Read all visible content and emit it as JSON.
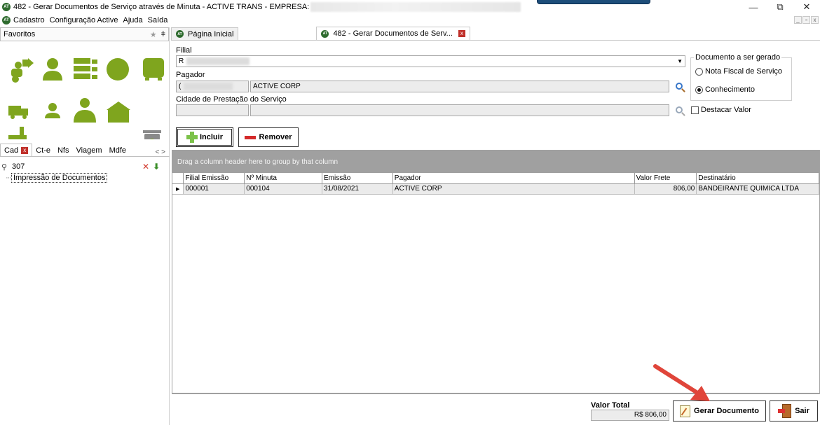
{
  "window": {
    "title": "482 - Gerar Documentos de Serviço através de Minuta - ACTIVE TRANS - EMPRESA: ",
    "logo_text": "AT",
    "controls": {
      "minimize": "—",
      "restore": "⧉",
      "close": "✕"
    }
  },
  "menu": {
    "items": [
      "Cadastro",
      "Configuração Active",
      "Ajuda",
      "Saída"
    ]
  },
  "left_panel": {
    "favorites_title": "Favoritos",
    "tabs": [
      {
        "label": "Cad",
        "active": true
      },
      {
        "label": "Ct-e"
      },
      {
        "label": "Nfs"
      },
      {
        "label": "Viagem"
      },
      {
        "label": "Mdfe"
      }
    ],
    "tab_arrows": "< >",
    "search_value": "307",
    "tree_item": "Impressão de Documentos",
    "icon_color": "#7fa51e"
  },
  "doc_tabs": [
    {
      "label": "Página Inicial"
    },
    {
      "label": "482 - Gerar Documentos de Serv...",
      "active": true
    }
  ],
  "form": {
    "filial_label": "Filial",
    "filial_value": "R",
    "pagador_label": "Pagador",
    "pagador_code": "(",
    "pagador_name": "ACTIVE CORP",
    "cidade_label": "Cidade de Prestação do Serviço",
    "doc_group_label": "Documento a ser gerado",
    "radio_nota": "Nota Fiscal de Serviço",
    "radio_conhecimento": "Conhecimento",
    "radio_selected": "conhecimento",
    "destacar_label": "Destacar Valor",
    "destacar_checked": false
  },
  "buttons": {
    "incluir": "Incluir",
    "remover": "Remover",
    "gerar": "Gerar Documento",
    "sair": "Sair"
  },
  "grid": {
    "group_hint": "Drag a column header here to group by that column",
    "columns": [
      "Filial Emissão",
      "Nº Minuta",
      "Emissão",
      "Pagador",
      "Valor Frete",
      "Destinatário"
    ],
    "rows": [
      [
        "000001",
        "000104",
        "31/08/2021",
        "ACTIVE CORP",
        "806,00",
        "BANDEIRANTE QUIMICA LTDA"
      ]
    ]
  },
  "footer": {
    "total_label": "Valor Total",
    "total_value": "R$ 806,00"
  },
  "colors": {
    "accent_green": "#7fa51e",
    "arrow_red": "#e0453a",
    "group_panel_gray": "#a0a0a0"
  }
}
